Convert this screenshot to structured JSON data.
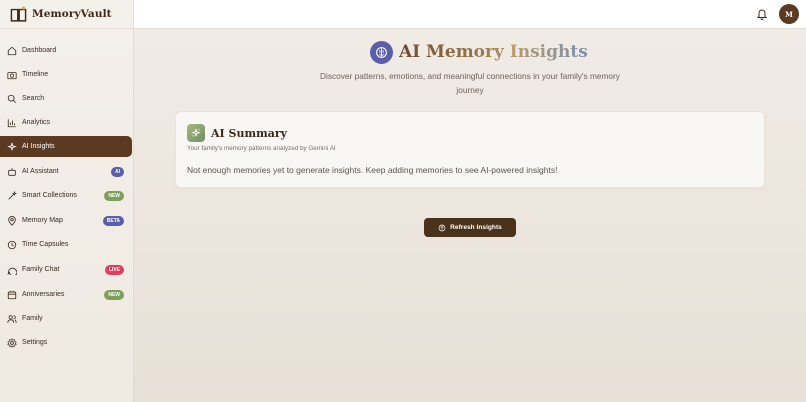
{
  "brand": {
    "name": "MemoryVault"
  },
  "sidebar": {
    "items": [
      {
        "label": "Dashboard",
        "icon": "home-icon"
      },
      {
        "label": "Timeline",
        "icon": "camera-icon"
      },
      {
        "label": "Search",
        "icon": "search-icon"
      },
      {
        "label": "Analytics",
        "icon": "bar-chart-icon"
      },
      {
        "label": "AI Insights",
        "icon": "sparkles-icon",
        "active": true
      },
      {
        "label": "AI Assistant",
        "icon": "bot-icon",
        "badge": "AI",
        "badge_color": "#5b5ea8"
      },
      {
        "label": "Smart Collections",
        "icon": "magic-wand-icon",
        "badge": "NEW",
        "badge_color": "#7e9f59"
      },
      {
        "label": "Memory Map",
        "icon": "map-pin-icon",
        "badge": "BETA",
        "badge_color": "#5b5ea8"
      },
      {
        "label": "Time Capsules",
        "icon": "clock-icon"
      },
      {
        "label": "Family Chat",
        "icon": "chat-bubble-icon",
        "badge": "LIVE",
        "badge_color": "#e23d5f"
      },
      {
        "label": "Anniversaries",
        "icon": "calendar-icon",
        "badge": "NEW",
        "badge_color": "#7e9f59"
      },
      {
        "label": "Family",
        "icon": "users-icon"
      },
      {
        "label": "Settings",
        "icon": "gear-icon"
      }
    ]
  },
  "topbar": {
    "avatar_initial": "M"
  },
  "page": {
    "title": "AI Memory Insights",
    "subtitle": "Discover patterns, emotions, and meaningful connections in your family's memory journey"
  },
  "summary_card": {
    "title": "AI Summary",
    "subtitle": "Your family's memory patterns analyzed by Gemini AI",
    "message": "Not enough memories yet to generate insights. Keep adding memories to see AI-powered insights!"
  },
  "actions": {
    "refresh_label": "Refresh Insights"
  },
  "colors": {
    "accent_brown": "#5a3b22",
    "brain_purple": "#5b5ea8",
    "badge_green": "#7e9f59",
    "badge_red": "#e23d5f"
  }
}
